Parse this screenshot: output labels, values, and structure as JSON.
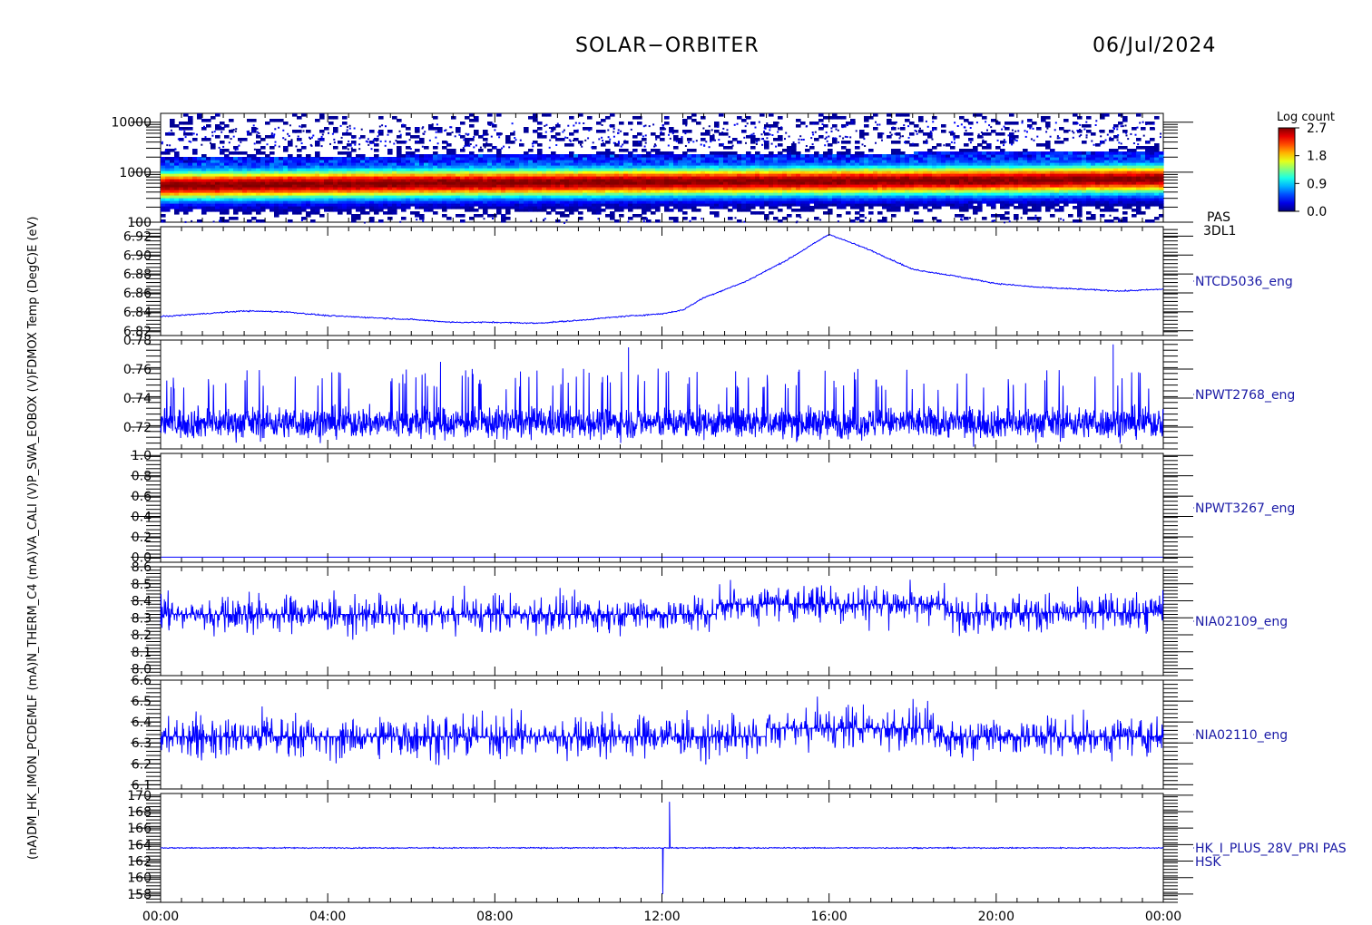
{
  "header": {
    "title": "SOLAR−ORBITER",
    "date": "06/Jul/2024"
  },
  "colors": {
    "trace": "#0000ff",
    "label": "#1a1aa6"
  },
  "colorbar": {
    "title": "Log count",
    "ticks": [
      "2.7",
      "1.8",
      "0.9",
      "0.0"
    ]
  },
  "y_axis_stack_label": "(nA)DM_HK_IMON_PCDEMLF (mA)N_THERM_C4 (mA)VA_CALI (V)P_SWA_EOBOX (V)FDMOX Temp (DegC)E (eV)",
  "chart_data": {
    "type": "line",
    "xlabel": "",
    "x_ticks": [
      "00:00",
      "04:00",
      "08:00",
      "12:00",
      "16:00",
      "20:00",
      "00:00"
    ],
    "x_range_hours": [
      0,
      24
    ],
    "panels": [
      {
        "id": "pas-spectrogram",
        "type": "heatmap",
        "name": "PAS",
        "name_line2": "3DL1",
        "y_scale": "log",
        "ylim": [
          100,
          15000
        ],
        "y_ticks": [
          "10000",
          "1000",
          "100"
        ],
        "z_label": "Log count",
        "z_range": [
          0.0,
          2.7
        ],
        "band_center_ev": [
          {
            "t": 0,
            "e": 550
          },
          {
            "t": 5,
            "e": 600
          },
          {
            "t": 12,
            "e": 650
          },
          {
            "t": 20,
            "e": 700
          },
          {
            "t": 24,
            "e": 750
          }
        ]
      },
      {
        "id": "ntcd5036",
        "type": "line",
        "name": "NTCD5036_eng",
        "ylim": [
          6.815,
          6.93
        ],
        "y_ticks": [
          "6.92",
          "6.90",
          "6.88",
          "6.86",
          "6.84",
          "6.82"
        ],
        "x": [
          0,
          1,
          2,
          3,
          4,
          5,
          6,
          7,
          8,
          9,
          10,
          11,
          12,
          12.5,
          13,
          14,
          15,
          16,
          17,
          18,
          19,
          20,
          21,
          22,
          23,
          24
        ],
        "values": [
          6.835,
          6.838,
          6.841,
          6.84,
          6.836,
          6.834,
          6.832,
          6.829,
          6.829,
          6.828,
          6.831,
          6.835,
          6.838,
          6.842,
          6.855,
          6.872,
          6.895,
          6.922,
          6.905,
          6.885,
          6.878,
          6.87,
          6.866,
          6.864,
          6.862,
          6.864
        ]
      },
      {
        "id": "npwt2768",
        "type": "line",
        "name": "NPWT2768_eng",
        "ylim": [
          0.705,
          0.78
        ],
        "y_ticks": [
          "0.78",
          "0.76",
          "0.74",
          "0.72"
        ],
        "baseline": 0.723,
        "noise_band": [
          0.715,
          0.745
        ],
        "spikes": [
          {
            "t": 11.2,
            "v": 0.775
          },
          {
            "t": 22.8,
            "v": 0.777
          },
          {
            "t": 6.7,
            "v": 0.765
          }
        ]
      },
      {
        "id": "npwt3267",
        "type": "line",
        "name": "NPWT3267_eng",
        "ylim": [
          -0.05,
          1.02
        ],
        "y_ticks": [
          "1.0",
          "0.8",
          "0.6",
          "0.4",
          "0.2",
          "0.0"
        ],
        "constant": 0.0
      },
      {
        "id": "nia02109",
        "type": "line",
        "name": "NIA02109_eng",
        "ylim": [
          7.96,
          8.6
        ],
        "y_ticks": [
          "8.6",
          "8.5",
          "8.4",
          "8.3",
          "8.2",
          "8.1",
          "8.0"
        ],
        "level_segments": [
          {
            "t0": 0,
            "t1": 13.3,
            "v": 8.32
          },
          {
            "t0": 13.3,
            "t1": 18.8,
            "v": 8.38
          },
          {
            "t0": 18.8,
            "t1": 24,
            "v": 8.33
          }
        ],
        "noise_band": [
          8.17,
          8.47
        ]
      },
      {
        "id": "nia02110",
        "type": "line",
        "name": "NIA02110_eng",
        "ylim": [
          6.08,
          6.6
        ],
        "y_ticks": [
          "6.6",
          "6.5",
          "6.4",
          "6.3",
          "6.2",
          "6.1"
        ],
        "level_segments": [
          {
            "t0": 0,
            "t1": 14.5,
            "v": 6.33
          },
          {
            "t0": 14.5,
            "t1": 18.5,
            "v": 6.37
          },
          {
            "t0": 18.5,
            "t1": 24,
            "v": 6.33
          }
        ],
        "noise_band": [
          6.2,
          6.47
        ]
      },
      {
        "id": "hk-i-plus-28v",
        "type": "line",
        "name": "HK_I_PLUS_28V_PRI PAS",
        "name_line2": "HSK",
        "ylim": [
          157,
          170.2
        ],
        "y_ticks": [
          "170",
          "168",
          "166",
          "164",
          "162",
          "160",
          "158"
        ],
        "baseline": 163.6,
        "events": [
          {
            "t": 12.02,
            "v": 158.0
          },
          {
            "t": 12.18,
            "v": 169.2
          }
        ]
      }
    ]
  }
}
